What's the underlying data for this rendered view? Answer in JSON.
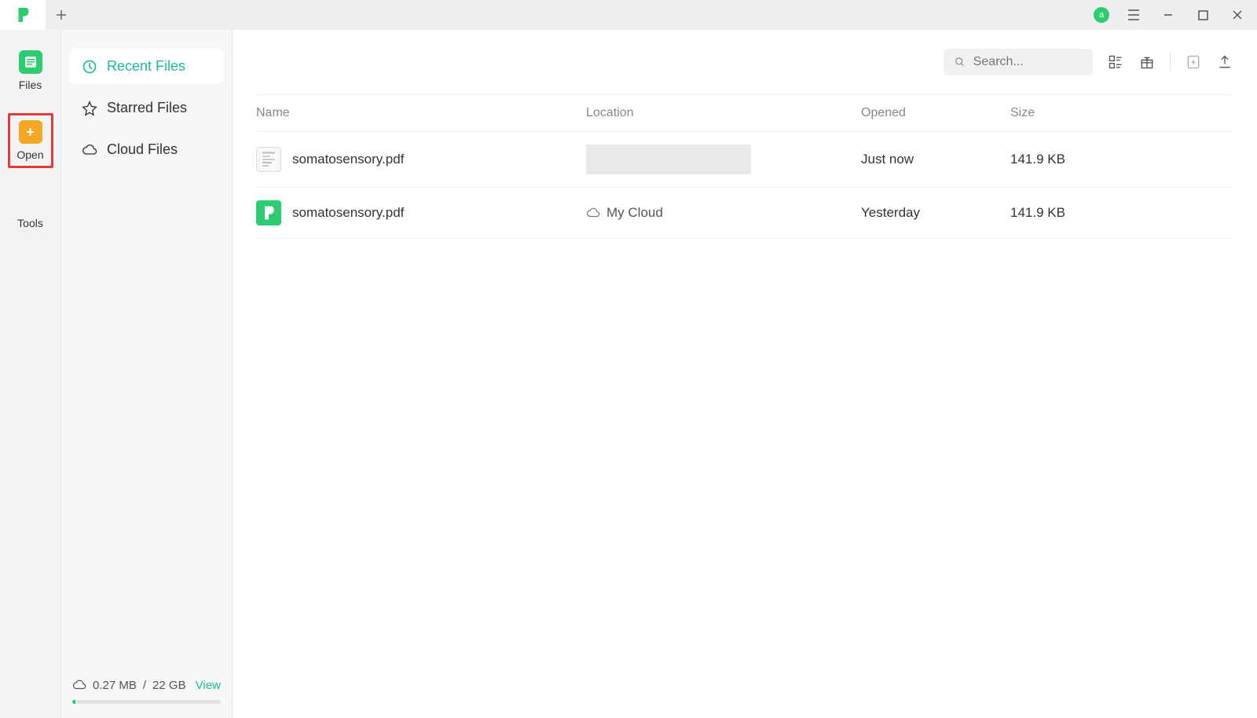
{
  "titlebar": {
    "user_initial": "a"
  },
  "rail": {
    "files_label": "Files",
    "open_label": "Open",
    "tools_label": "Tools"
  },
  "sidebar": {
    "items": [
      {
        "label": "Recent Files",
        "icon": "clock"
      },
      {
        "label": "Starred Files",
        "icon": "star"
      },
      {
        "label": "Cloud Files",
        "icon": "cloud"
      }
    ],
    "storage": {
      "used": "0.27 MB",
      "separator": "/",
      "total": "22 GB",
      "view_label": "View"
    }
  },
  "toolbar": {
    "search_placeholder": "Search..."
  },
  "table": {
    "headers": {
      "name": "Name",
      "location": "Location",
      "opened": "Opened",
      "size": "Size"
    },
    "rows": [
      {
        "name": "somatosensory.pdf",
        "location_type": "placeholder",
        "location": "",
        "opened": "Just now",
        "size": "141.9 KB",
        "icon": "pdf"
      },
      {
        "name": "somatosensory.pdf",
        "location_type": "cloud",
        "location": "My Cloud",
        "opened": "Yesterday",
        "size": "141.9 KB",
        "icon": "cloud-pdf"
      }
    ]
  }
}
